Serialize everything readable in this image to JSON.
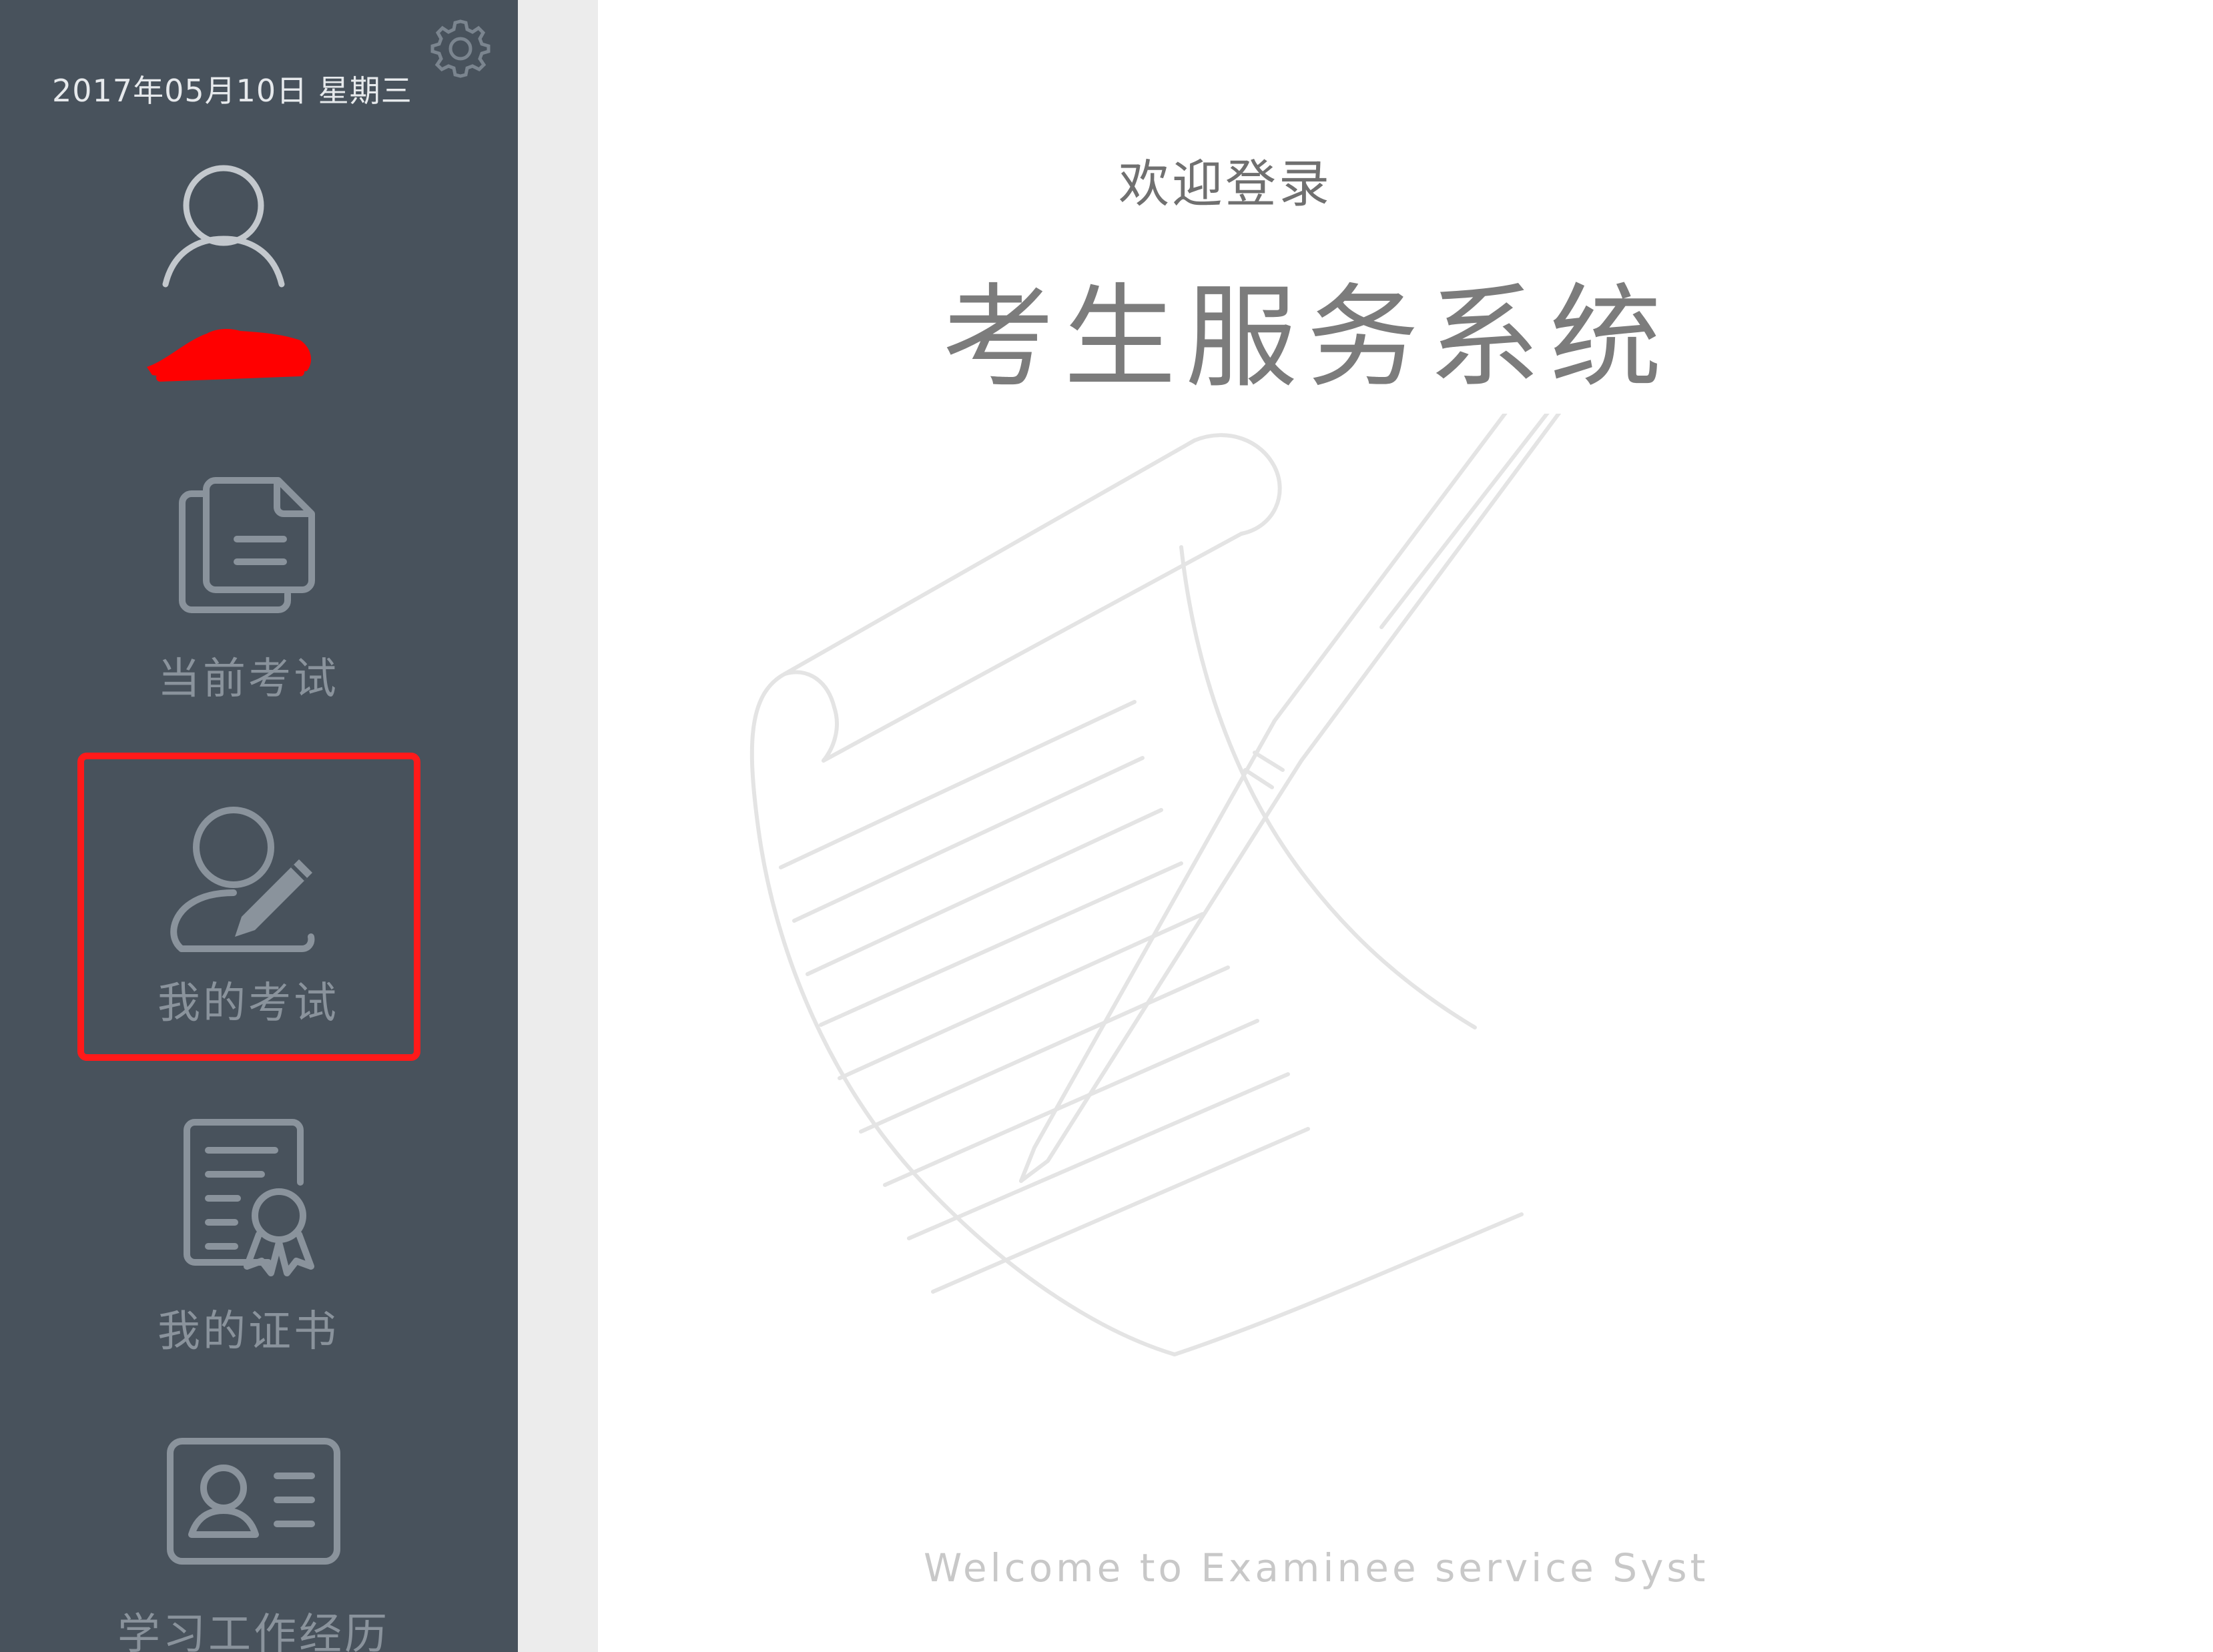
{
  "sidebar": {
    "date": "2017年05月10日 星期三",
    "settings_icon": "gear-icon",
    "avatar_icon": "user-icon",
    "username_redacted": true,
    "items": [
      {
        "label": "当前考试",
        "icon": "documents-icon"
      },
      {
        "label": "我的考试",
        "icon": "user-edit-icon",
        "highlighted": true
      },
      {
        "label": "我的证书",
        "icon": "certificate-icon"
      },
      {
        "label": "学习工作经历",
        "icon": "id-card-icon"
      }
    ]
  },
  "main": {
    "welcome": "欢迎登录",
    "title": "考生服务系统",
    "tagline": "Welcome to Examinee service Syst",
    "illustration": "scroll-and-pen-illustration"
  },
  "colors": {
    "sidebar_bg": "#48525c",
    "gutter_bg": "#ececec",
    "highlight": "#ff1a1a",
    "nav_text": "#8a939c"
  }
}
